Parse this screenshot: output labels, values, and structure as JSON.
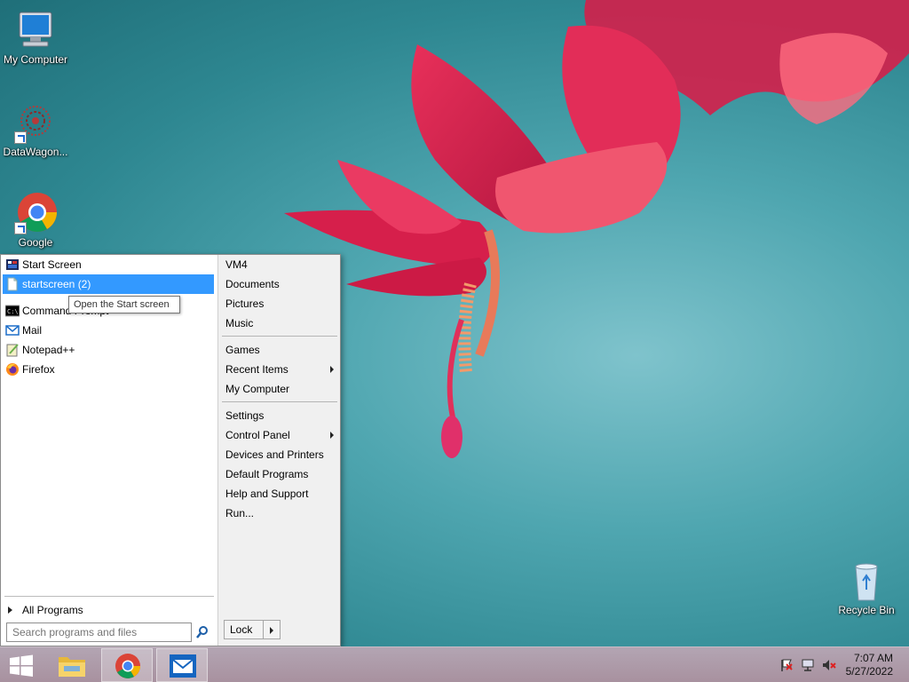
{
  "desktop": {
    "icons": [
      {
        "label": "My Computer"
      },
      {
        "label": "DataWagon..."
      },
      {
        "label": "Google"
      },
      {
        "label": "Recycle Bin"
      }
    ]
  },
  "start_menu": {
    "programs": [
      {
        "label": "Start Screen",
        "icon": "start-screen-icon"
      },
      {
        "label": "startscreen (2)",
        "icon": "document-icon",
        "selected": true
      },
      {
        "label": "Command Prompt",
        "icon": "cmd-icon"
      },
      {
        "label": "Mail",
        "icon": "mail-icon"
      },
      {
        "label": "Notepad++",
        "icon": "notepad-icon"
      },
      {
        "label": "Firefox",
        "icon": "firefox-icon"
      }
    ],
    "tooltip": "Open the Start screen",
    "all_programs": "All Programs",
    "search_placeholder": "Search programs and files",
    "right_items": [
      {
        "label": "VM4"
      },
      {
        "label": "Documents"
      },
      {
        "label": "Pictures"
      },
      {
        "label": "Music"
      },
      {
        "label": "Games"
      },
      {
        "label": "Recent Items",
        "submenu": true
      },
      {
        "label": "My Computer"
      },
      {
        "label": "Settings"
      },
      {
        "label": "Control Panel",
        "submenu": true
      },
      {
        "label": "Devices and Printers"
      },
      {
        "label": "Default Programs"
      },
      {
        "label": "Help and Support"
      },
      {
        "label": "Run..."
      }
    ],
    "lock_label": "Lock"
  },
  "taskbar": {
    "buttons": [
      "start-button",
      "file-explorer",
      "google-chrome",
      "mail"
    ],
    "clock": {
      "time": "7:07 AM",
      "date": "5/27/2022"
    }
  },
  "colors": {
    "selection": "#3399ff",
    "taskbar": "#a8919f",
    "wallpaper": "#4fa6b0"
  }
}
